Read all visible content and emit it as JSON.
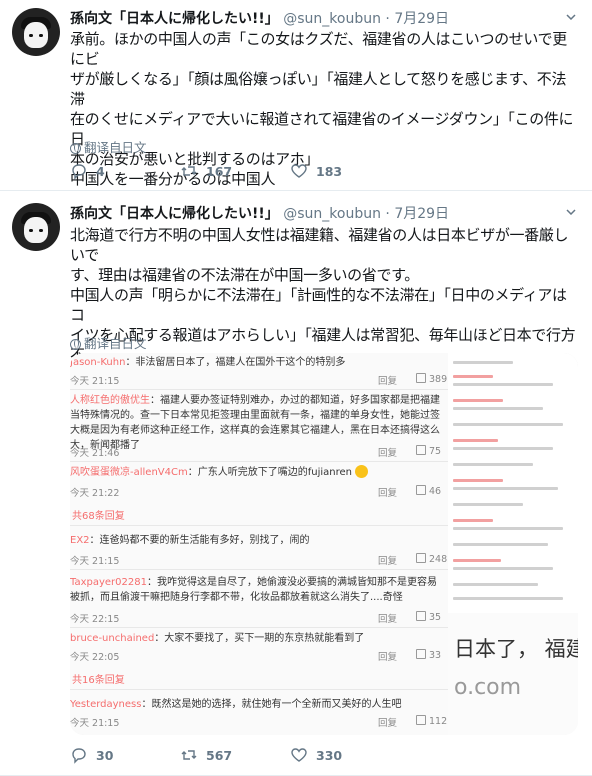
{
  "tweets": [
    {
      "name": "孫向文「日本人に帰化したい!!」",
      "handle": "@sun_koubun",
      "dot": "·",
      "date": "7月29日",
      "lines": [
        "承前。ほかの中国人の声「この女はクズだ、福建省の人はこいつのせいで更にビ",
        "ザが厳しくなる」「顔は風俗嬢っぽい」「福建人として怒りを感じます、不法滞",
        "在のくせにメディアで大いに報道されて福建省のイメージダウン」「この件に日",
        "本の治安が悪いと批判するのはアホ」",
        "中国人を一番分かるのは中国人"
      ],
      "translate": "翻译自日文",
      "replies": "4",
      "retweets": "167",
      "likes": "183"
    },
    {
      "name": "孫向文「日本人に帰化したい!!」",
      "handle": "@sun_koubun",
      "dot": "·",
      "date": "7月29日",
      "lines": [
        "北海道で行方不明の中国人女性は福建籍、福建省の人は日本ビザが一番厳しいで",
        "す、理由は福建省の不法滞在が中国一多いの省です。",
        "中国人の声「明らかに不法滞在」「計画性的な不法滞在」「日中のメディアはコ",
        "イツを心配する報道はアホらしい」「福建人は常習犯、毎年山ほど日本で行方不",
        "明」"
      ],
      "translate": "翻译自日文",
      "replies": "30",
      "retweets": "567",
      "likes": "330"
    }
  ],
  "embedded": {
    "comments": [
      {
        "user": "Jason-Kuhn",
        "text": "：非法留居日本了，福建人在国外干这个的特别多",
        "time": "今天 21:15",
        "reply": "回复",
        "likes": "389"
      },
      {
        "user": "人称红色的傲优生",
        "text": "：福建人要办签证特别难办，办过的都知道，好多国家都是把福建当特殊情况的。查一下日本常见拒签理由里面就有一条，福建的单身女性，她能过签大概是因为有老师这种正经工作，这样真的会连累其它福建人，黑在日本还搞得这么大，新闻都播了",
        "time": "今天 21:46",
        "reply": "回复",
        "likes": "75"
      },
      {
        "user": "风吹蛋蛋微凉-allenV4Cm",
        "text": "：广东人听完放下了嘴边的fujianren",
        "time": "今天 21:22",
        "reply": "回复",
        "likes": "46"
      },
      {
        "user": "EX2",
        "text": "：连爸妈都不要的新生活能有多好，别找了，闹的",
        "time": "今天 21:15",
        "reply": "回复",
        "likes": "248"
      },
      {
        "user": "Taxpayer02281",
        "text": "：我咋觉得这是自尽了，她偷渡没必要搞的满城皆知那不是更容易被抓，而且偷渡干嘛把随身行李都不带，化妆品都放着就这么消失了....奇怪",
        "time": "今天 22:15",
        "reply": "回复",
        "likes": "35"
      },
      {
        "user": "bruce-unchained",
        "text": "：大家不要找了，买下一期的东京热就能看到了",
        "time": "今天 22:05",
        "reply": "回复",
        "likes": "33"
      },
      {
        "user": "Yesterdayness",
        "text": "：既然这是她的选择，就住她有一个全新而又美好的人生吧",
        "time": "今天 21:15",
        "reply": "回复",
        "likes": "112"
      }
    ],
    "expand_1": "共68条回复",
    "expand_2": "共16条回复",
    "right_big_text": "日本了，  福建",
    "right_com_text": "o.com"
  },
  "icons": [
    "reply-icon",
    "retweet-icon",
    "like-icon",
    "globe-icon",
    "caret-down-icon"
  ],
  "colors": {
    "text": "#14171a",
    "muted": "#657786",
    "comment_user": "#f56d6d"
  }
}
